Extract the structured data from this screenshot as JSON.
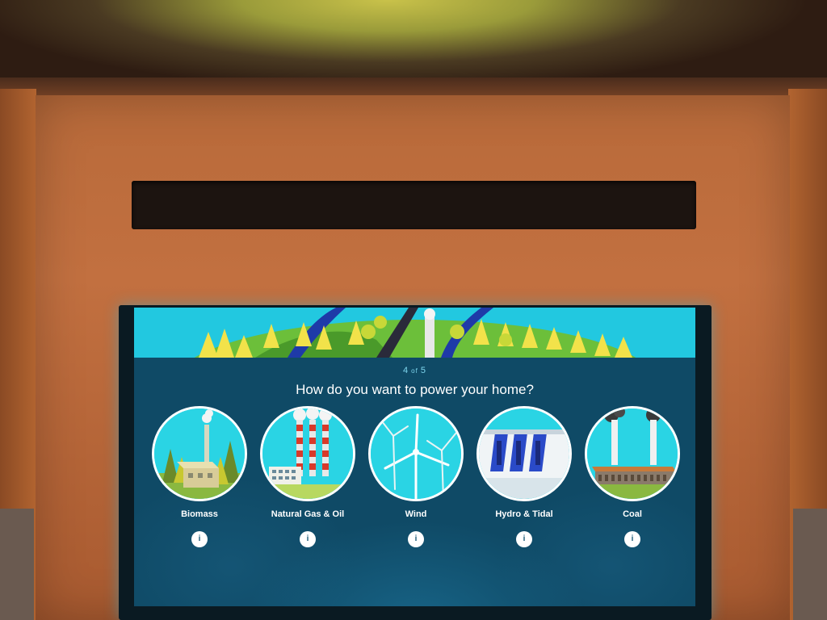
{
  "progress": {
    "current": "4",
    "separator": "of",
    "total": "5"
  },
  "question": "How do you want to power your home?",
  "options": [
    {
      "label": "Biomass",
      "info": "i",
      "icon": "biomass-plant-icon"
    },
    {
      "label": "Natural Gas & Oil",
      "info": "i",
      "icon": "gas-oil-plant-icon"
    },
    {
      "label": "Wind",
      "info": "i",
      "icon": "wind-turbine-icon"
    },
    {
      "label": "Hydro & Tidal",
      "info": "i",
      "icon": "hydro-dam-icon"
    },
    {
      "label": "Coal",
      "info": "i",
      "icon": "coal-plant-icon"
    }
  ],
  "colors": {
    "screen_bg": "#0f4a66",
    "sky": "#2ad4e4",
    "text": "#ffffff",
    "counter": "#7fd6ee"
  }
}
